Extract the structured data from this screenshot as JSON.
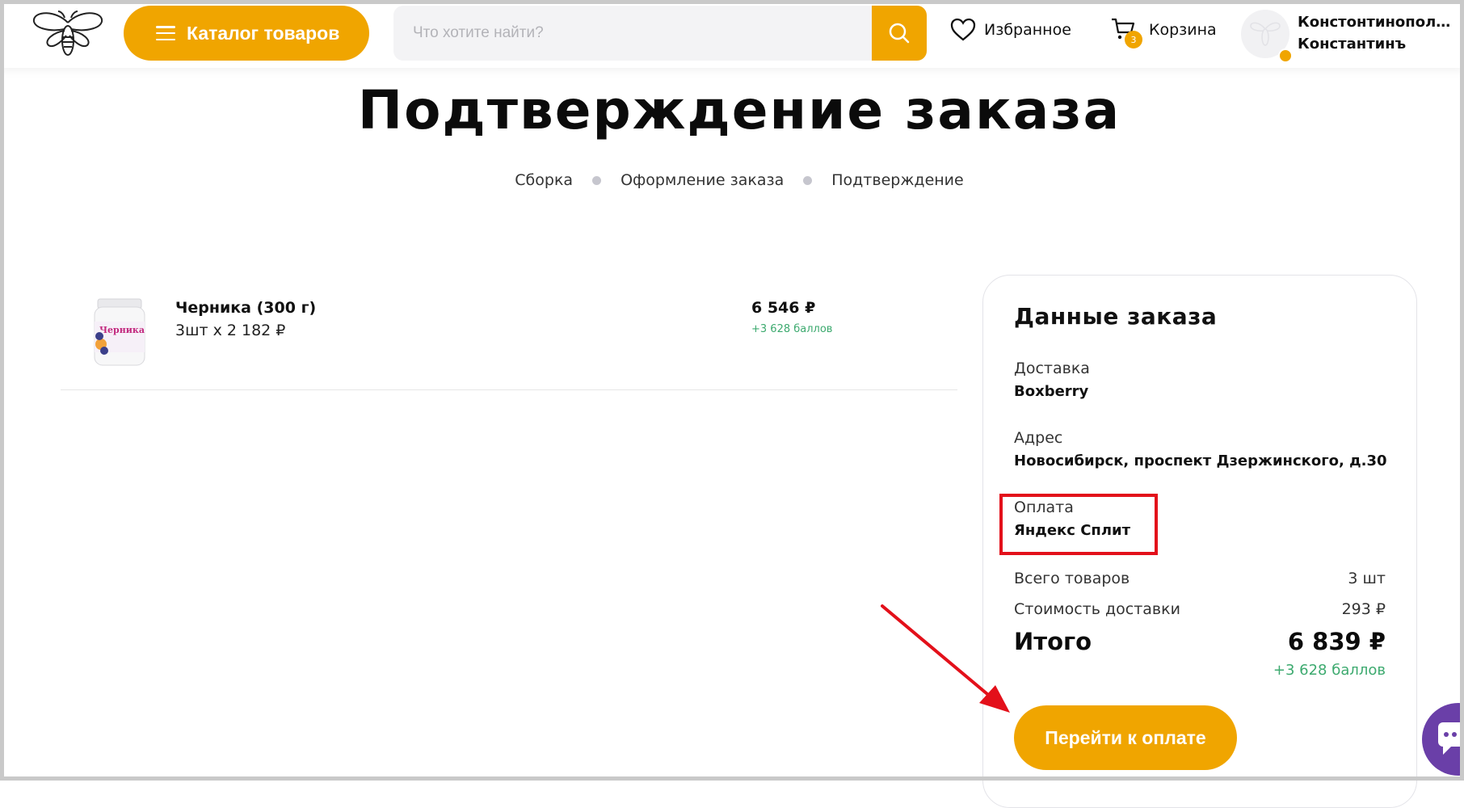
{
  "header": {
    "catalog_label": "Каталог товаров",
    "search_placeholder": "Что хотите найти?",
    "favorites_label": "Избранное",
    "cart_label": "Корзина",
    "cart_count": "3",
    "user_name_line1": "Констонтинопол…",
    "user_name_line2": "Константинъ"
  },
  "page": {
    "title": "Подтверждение заказа",
    "steps": [
      "Сборка",
      "Оформление заказа",
      "Подтверждение"
    ]
  },
  "product": {
    "image_label": "Черника",
    "name": "Черника (300 г)",
    "qty_price": "3шт x 2 182 ₽",
    "price": "6 546 ₽",
    "bonus": "+3 628 баллов"
  },
  "order": {
    "title": "Данные заказа",
    "delivery_label": "Доставка",
    "delivery_value": "Boxberry",
    "address_label": "Адрес",
    "address_value": "Новосибирск, проспект Дзержинского, д.30",
    "payment_label": "Оплата",
    "payment_value": "Яндекс Сплит",
    "items_label": "Всего товаров",
    "items_value": "3 шт",
    "shipping_label": "Стоимость доставки",
    "shipping_value": "293 ₽",
    "total_label": "Итого",
    "total_value": "6 839 ₽",
    "total_bonus": "+3 628 баллов",
    "pay_button": "Перейти к оплате"
  },
  "colors": {
    "accent": "#f0a500",
    "bonus_green": "#3daa6f",
    "highlight_red": "#e3101a",
    "chat_purple": "#6a3fa8"
  }
}
